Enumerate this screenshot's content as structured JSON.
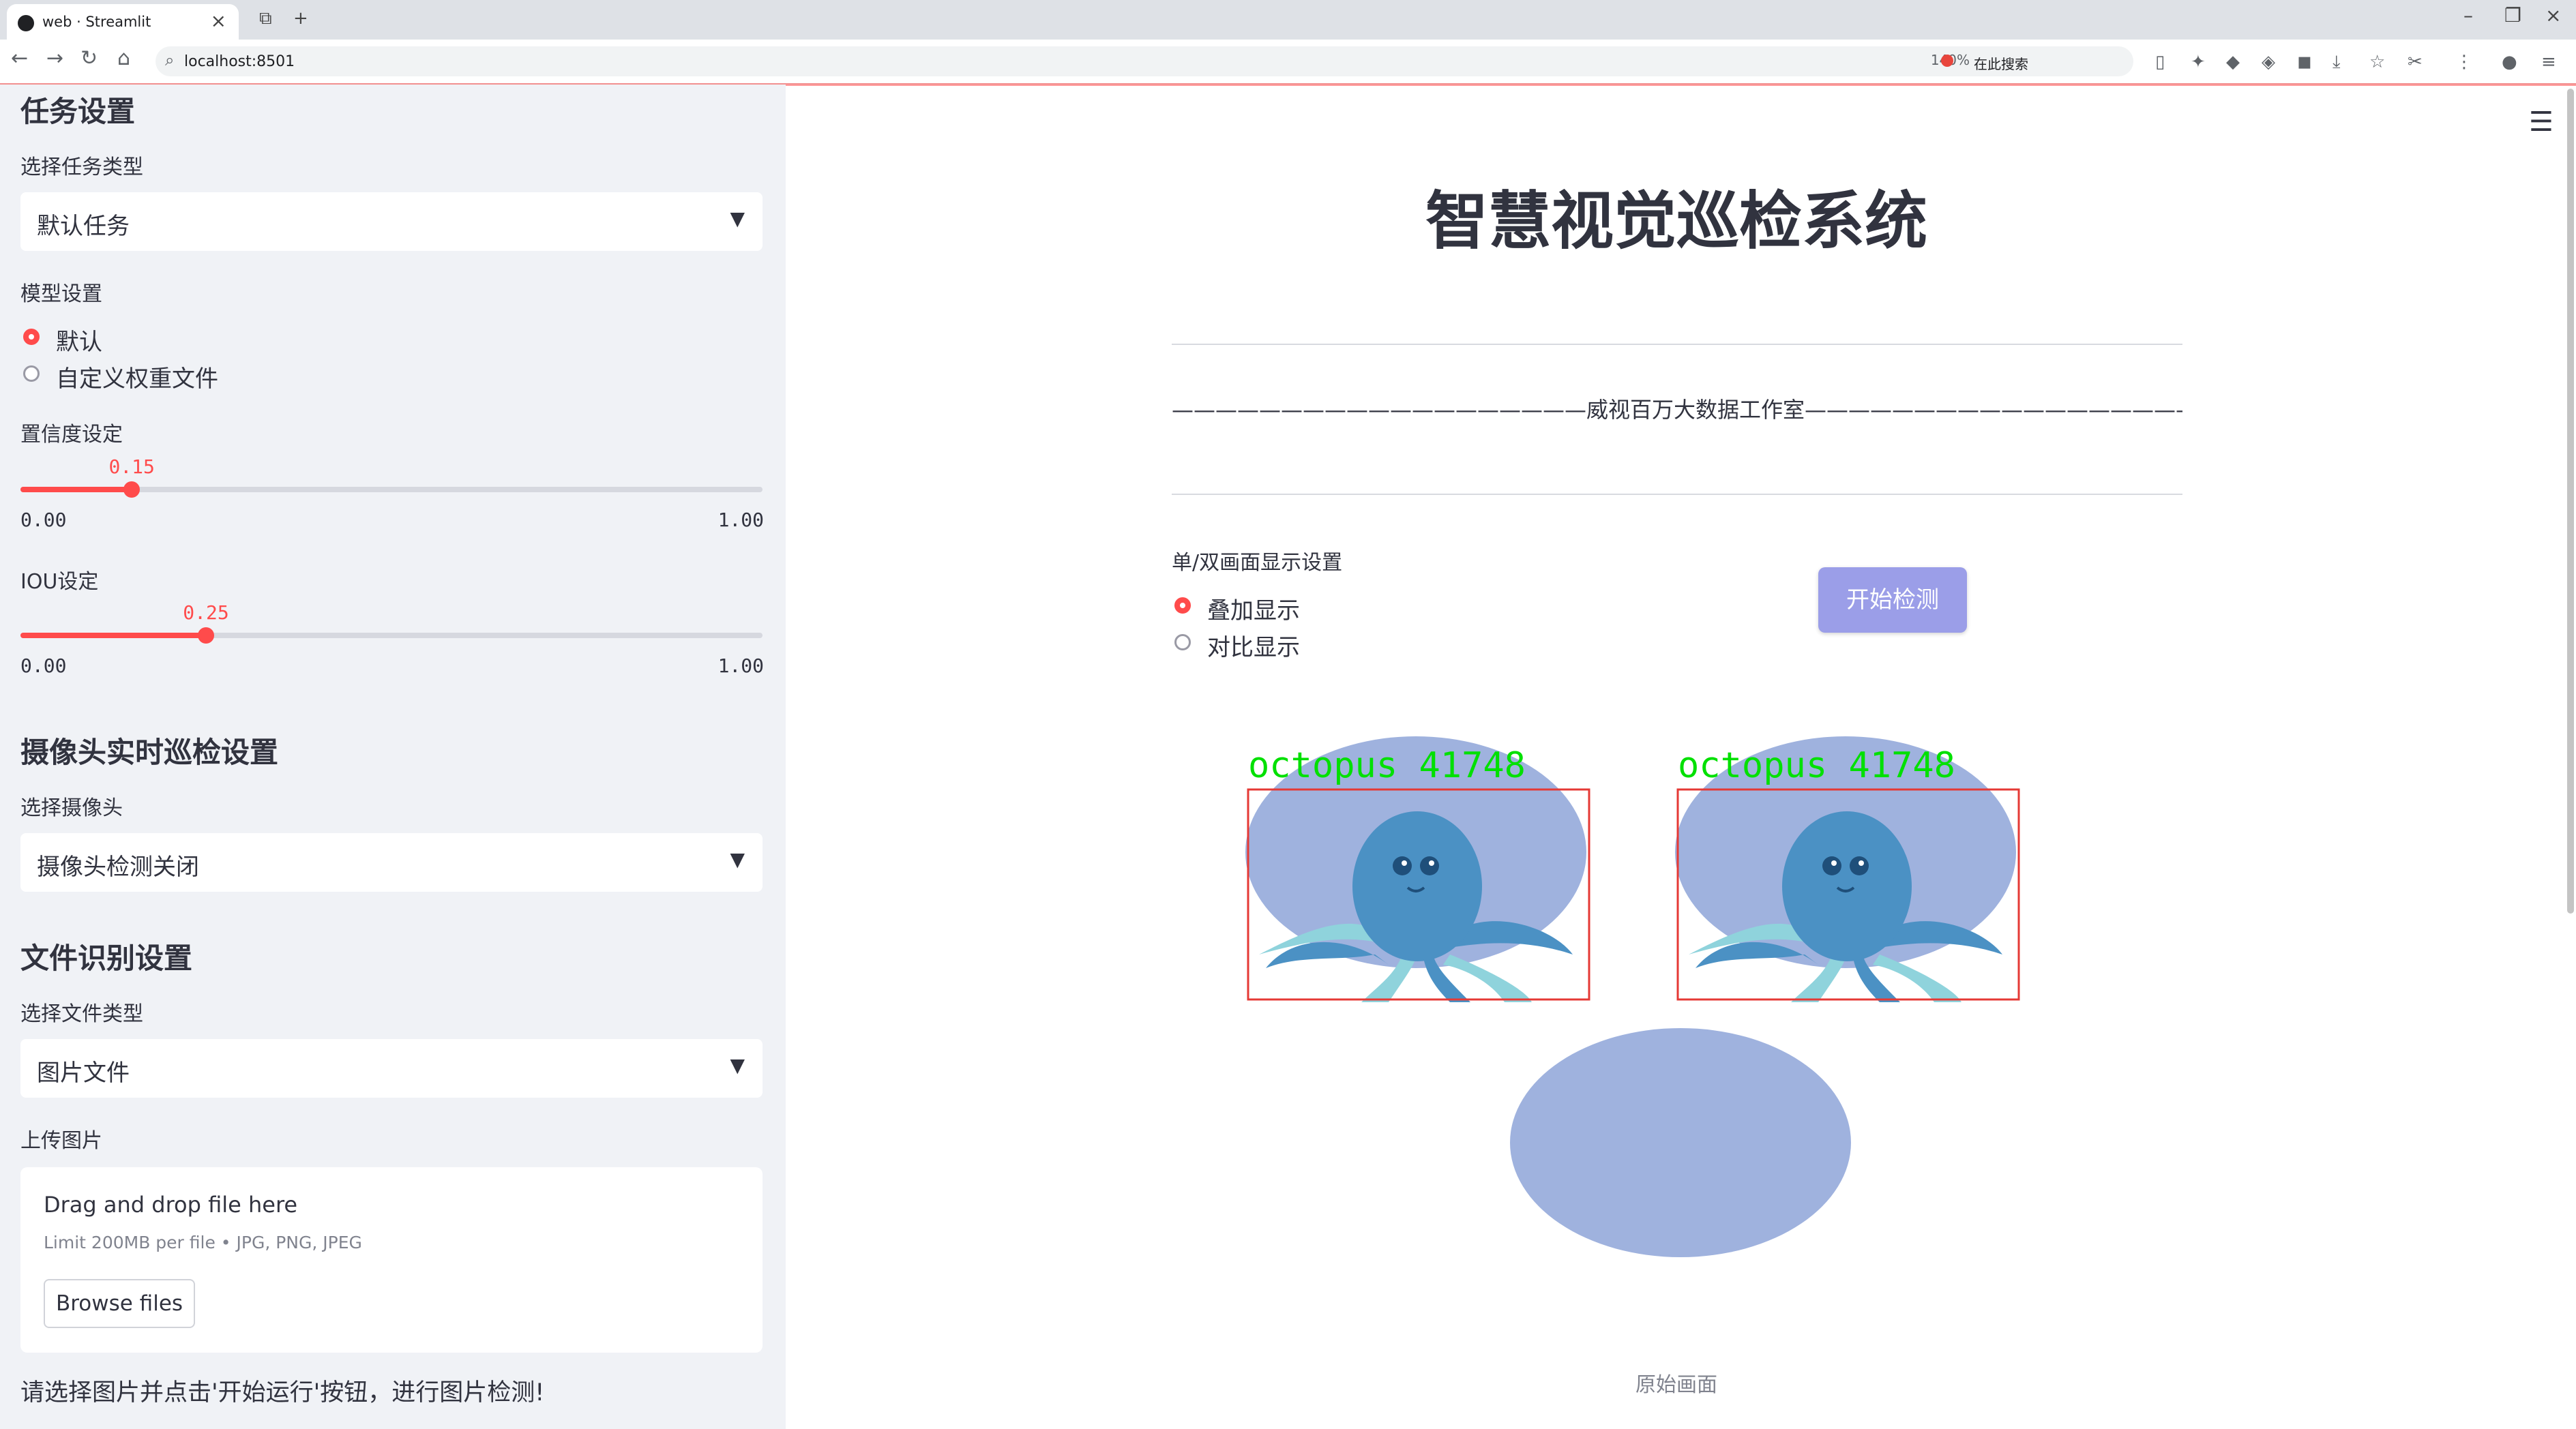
{
  "browser": {
    "tab_title": "web · Streamlit",
    "url": "localhost:8501",
    "zoom": "140%",
    "search_placeholder": "在此搜索"
  },
  "sidebar": {
    "task_section": {
      "heading": "任务设置",
      "task_type_label": "选择任务类型",
      "task_type_value": "默认任务"
    },
    "model_section": {
      "label": "模型设置",
      "options": [
        "默认",
        "自定义权重文件"
      ],
      "selected": "默认"
    },
    "confidence": {
      "label": "置信度设定",
      "value": "0.15",
      "value_num": 0.15,
      "min": "0.00",
      "max": "1.00"
    },
    "iou": {
      "label": "IOU设定",
      "value": "0.25",
      "value_num": 0.25,
      "min": "0.00",
      "max": "1.00"
    },
    "camera_section": {
      "heading": "摄像头实时巡检设置",
      "label": "选择摄像头",
      "value": "摄像头检测关闭"
    },
    "file_section": {
      "heading": "文件识别设置",
      "label": "选择文件类型",
      "value": "图片文件",
      "upload_label": "上传图片",
      "drag_text": "Drag and drop file here",
      "limit_text": "Limit 200MB per file • JPG, PNG, JPEG",
      "browse_label": "Browse files"
    },
    "hint": "请选择图片并点击'开始运行'按钮，进行图片检测!"
  },
  "main": {
    "title": "智慧视觉巡检系统",
    "divider_text": "———————————————————威视百万大数据工作室————————————————————",
    "display_label": "单/双画面显示设置",
    "display_options": [
      "叠加显示",
      "对比显示"
    ],
    "display_selected": "叠加显示",
    "start_button": "开始检测",
    "detections": [
      {
        "label": "octopus  41748"
      },
      {
        "label": "octopus  41748"
      }
    ],
    "caption": "原始画面"
  },
  "colors": {
    "accent": "#ff4b4b",
    "sidebar_bg": "#f0f2f6",
    "button": "#9b9ee8",
    "detection_box": "#e53935",
    "detection_text": "#00e000"
  },
  "icons": [
    "streamlit-favicon",
    "close-icon",
    "new-tab-icon",
    "back-icon",
    "forward-icon",
    "reload-icon",
    "home-icon",
    "chevron-down-icon",
    "hamburger-menu-icon"
  ]
}
